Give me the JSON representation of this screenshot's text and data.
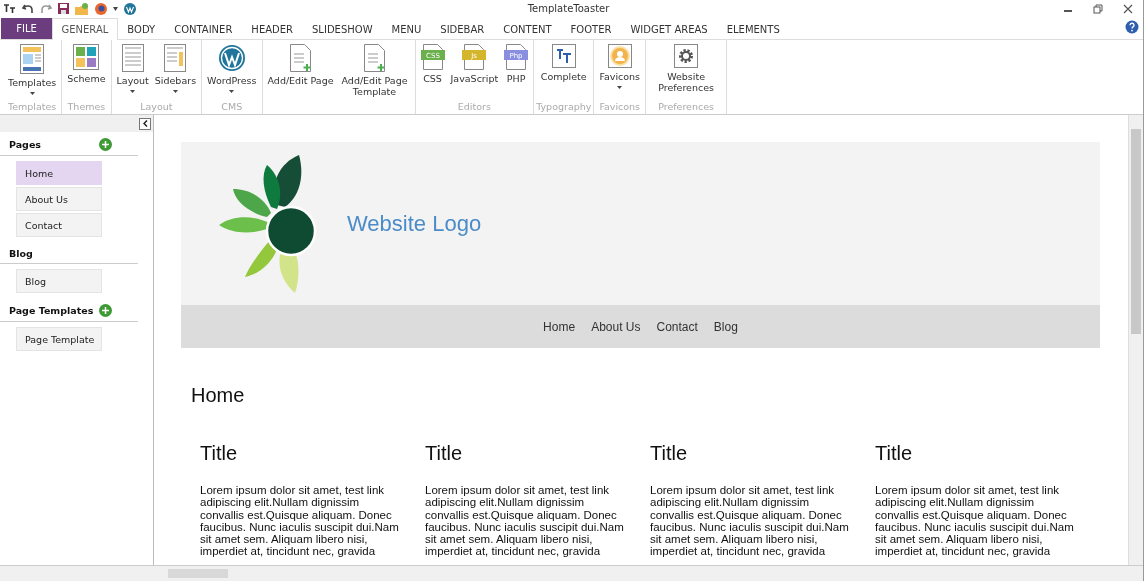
{
  "window": {
    "title": "TemplateToaster"
  },
  "file_tab": {
    "label": "FILE"
  },
  "tabs": [
    {
      "label": "GENERAL",
      "selected": true
    },
    {
      "label": "BODY",
      "selected": false
    },
    {
      "label": "CONTAINER",
      "selected": false
    },
    {
      "label": "HEADER",
      "selected": false
    },
    {
      "label": "SLIDESHOW",
      "selected": false
    },
    {
      "label": "MENU",
      "selected": false
    },
    {
      "label": "SIDEBAR",
      "selected": false
    },
    {
      "label": "CONTENT",
      "selected": false
    },
    {
      "label": "FOOTER",
      "selected": false
    },
    {
      "label": "WIDGET AREAS",
      "selected": false
    },
    {
      "label": "ELEMENTS",
      "selected": false
    }
  ],
  "ribbon": [
    {
      "label": "Templates",
      "buttons": [
        {
          "kind": "templates",
          "label": "Templates",
          "dropdown": true
        }
      ]
    },
    {
      "label": "Themes",
      "buttons": [
        {
          "kind": "scheme",
          "label": "Scheme",
          "dropdown": false
        }
      ]
    },
    {
      "label": "Layout",
      "buttons": [
        {
          "kind": "layout",
          "label": "Layout",
          "dropdown": true
        },
        {
          "kind": "sidebars",
          "label": "Sidebars",
          "dropdown": true
        }
      ]
    },
    {
      "label": "CMS",
      "buttons": [
        {
          "kind": "wordpress",
          "label": "WordPress",
          "dropdown": true
        }
      ]
    },
    {
      "buttons": [
        {
          "kind": "page",
          "label": "Add/Edit Page",
          "dropdown": false
        },
        {
          "kind": "page",
          "label": "Add/Edit Page Template",
          "dropdown": false
        }
      ]
    },
    {
      "label": "Editors",
      "buttons": [
        {
          "kind": "file",
          "badge": "CSS",
          "color": "#6ab04c",
          "label": "CSS",
          "dropdown": false
        },
        {
          "kind": "file",
          "badge": "Js",
          "color": "#d4b62c",
          "label": "JavaScript",
          "dropdown": false
        },
        {
          "kind": "file",
          "badge": "Php",
          "color": "#8a8ee0",
          "label": "PHP",
          "dropdown": false
        }
      ]
    },
    {
      "label": "Typography",
      "buttons": [
        {
          "kind": "typography",
          "label": "Complete",
          "dropdown": false
        }
      ]
    },
    {
      "label": "Favicons",
      "buttons": [
        {
          "kind": "favicon",
          "label": "Favicons",
          "dropdown": true
        }
      ]
    },
    {
      "label": "Preferences",
      "buttons": [
        {
          "kind": "gear",
          "label": "Website Preferences",
          "dropdown": false
        }
      ]
    }
  ],
  "sidebar": {
    "sections": [
      {
        "title": "Pages",
        "add": true,
        "items": [
          {
            "label": "Home",
            "selected": true
          },
          {
            "label": "About Us",
            "selected": false
          },
          {
            "label": "Contact",
            "selected": false
          }
        ]
      },
      {
        "title": "Blog",
        "add": false,
        "items": [
          {
            "label": "Blog",
            "selected": false
          }
        ]
      },
      {
        "title": "Page Templates",
        "add": true,
        "items": [
          {
            "label": "Page Template",
            "selected": false
          }
        ]
      }
    ]
  },
  "preview": {
    "logo_text": "Website Logo",
    "nav": [
      "Home",
      "About Us",
      "Contact",
      "Blog"
    ],
    "heading": "Home",
    "columns": [
      {
        "title": "Title",
        "body": "Lorem ipsum dolor sit amet, test link adipiscing elit.Nullam dignissim convallis est.Quisque aliquam. Donec faucibus. Nunc iaculis suscipit dui.Nam sit amet sem. Aliquam libero nisi, imperdiet at, tincidunt nec, gravida"
      },
      {
        "title": "Title",
        "body": "Lorem ipsum dolor sit amet, test link adipiscing elit.Nullam dignissim convallis est.Quisque aliquam. Donec faucibus. Nunc iaculis suscipit dui.Nam sit amet sem. Aliquam libero nisi, imperdiet at, tincidunt nec, gravida"
      },
      {
        "title": "Title",
        "body": "Lorem ipsum dolor sit amet, test link adipiscing elit.Nullam dignissim convallis est.Quisque aliquam. Donec faucibus. Nunc iaculis suscipit dui.Nam sit amet sem. Aliquam libero nisi, imperdiet at, tincidunt nec, gravida"
      },
      {
        "title": "Title",
        "body": "Lorem ipsum dolor sit amet, test link adipiscing elit.Nullam dignissim convallis est.Quisque aliquam. Donec faucibus. Nunc iaculis suscipit dui.Nam sit amet sem. Aliquam libero nisi, imperdiet at, tincidunt nec, gravida"
      }
    ]
  }
}
